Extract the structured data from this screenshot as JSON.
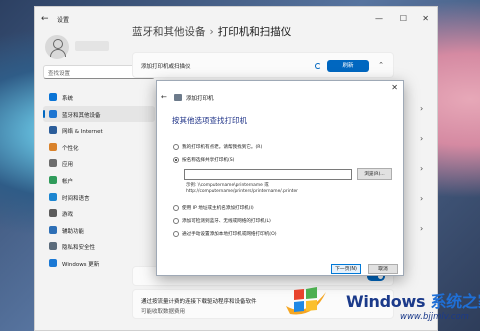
{
  "app_title": "设置",
  "search": {
    "placeholder": "查找设置"
  },
  "nav": {
    "items": [
      {
        "label": "系统",
        "color": "#0a74d6"
      },
      {
        "label": "蓝牙和其他设备",
        "color": "#1d75d1",
        "active": true
      },
      {
        "label": "网络 & Internet",
        "color": "#2b5d9a"
      },
      {
        "label": "个性化",
        "color": "#d9822b"
      },
      {
        "label": "应用",
        "color": "#6c6c6c"
      },
      {
        "label": "帐户",
        "color": "#2f9b5a"
      },
      {
        "label": "时间和语言",
        "color": "#1c86d1"
      },
      {
        "label": "游戏",
        "color": "#5b5b5b"
      },
      {
        "label": "辅助功能",
        "color": "#2d6fb6"
      },
      {
        "label": "隐私和安全性",
        "color": "#5b6b7b"
      },
      {
        "label": "Windows 更新",
        "color": "#1a78d4"
      }
    ]
  },
  "breadcrumb": {
    "parent": "蓝牙和其他设备",
    "separator": "›",
    "current": "打印机和扫描仪"
  },
  "add_row": {
    "label": "添加打印机或扫描仪",
    "refresh": "刷新"
  },
  "meter_row": {
    "line1": "通过按流量计费的连接下载驱动程序和设备软件",
    "line2": "可能收取数据费用"
  },
  "dialog": {
    "title": "添加打印机",
    "heading": "按其他选项查找打印机",
    "options": [
      {
        "label": "我的打印机有点老。请帮我找到它。(R)",
        "checked": false
      },
      {
        "label": "按名称选择共享打印机(S)",
        "checked": true
      },
      {
        "label": "使用 IP 地址或主机名添加打印机(I)",
        "checked": false
      },
      {
        "label": "添加可检测到蓝牙、无线或网络的打印机(L)",
        "checked": false
      },
      {
        "label": "通过手动设置添加本地打印机或网络打印机(O)",
        "checked": false
      }
    ],
    "path_value": "",
    "browse": "浏览(R)...",
    "example_line1": "示例: \\\\computername\\printername 或",
    "example_line2": "http://computername/printers/printername/.printer",
    "next": "下一页(N)",
    "cancel": "取消"
  },
  "watermark": {
    "brand": "Windows",
    "cn": "系统之家",
    "url": "www.bjjmlv.com"
  }
}
